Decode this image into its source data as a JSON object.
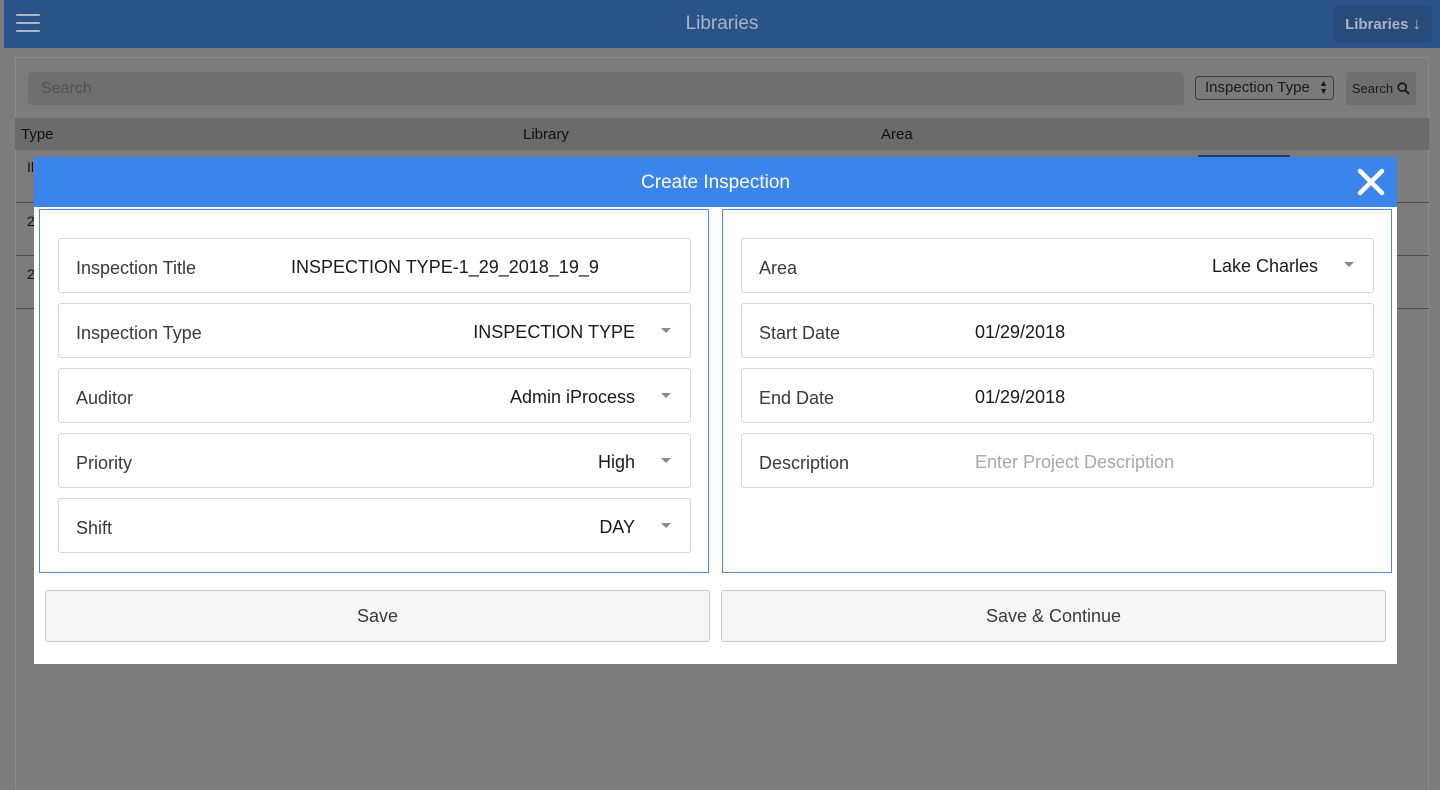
{
  "header": {
    "title": "Libraries",
    "menu_icon": "hamburger-icon",
    "libraries_button_label": "Libraries",
    "libraries_button_icon": "arrow-down-icon",
    "bar_color": "#2a5389"
  },
  "toolbar": {
    "search_placeholder": "Search",
    "filter_selected": "Inspection Type",
    "search_button_label": "Search",
    "search_button_icon": "magnifier-icon"
  },
  "table": {
    "columns": [
      "Type",
      "Library",
      "Area"
    ],
    "row_fragments": [
      "Il",
      "2",
      "2"
    ]
  },
  "modal": {
    "title": "Create Inspection",
    "header_color": "#3b84ec",
    "close_icon": "close-icon",
    "left_fields": [
      {
        "label": "Inspection Title",
        "value": "INSPECTION TYPE-1_29_2018_19_9"
      },
      {
        "label": "Inspection Type",
        "value": "INSPECTION TYPE"
      },
      {
        "label": "Auditor",
        "value": "Admin iProcess"
      },
      {
        "label": "Priority",
        "value": "High"
      },
      {
        "label": "Shift",
        "value": "DAY"
      }
    ],
    "right_fields": [
      {
        "label": "Area",
        "value": "Lake Charles"
      },
      {
        "label": "Start Date",
        "value": "01/29/2018"
      },
      {
        "label": "End Date",
        "value": "01/29/2018"
      },
      {
        "label": "Description",
        "placeholder": "Enter Project Description"
      }
    ],
    "save_label": "Save",
    "save_continue_label": "Save & Continue"
  }
}
